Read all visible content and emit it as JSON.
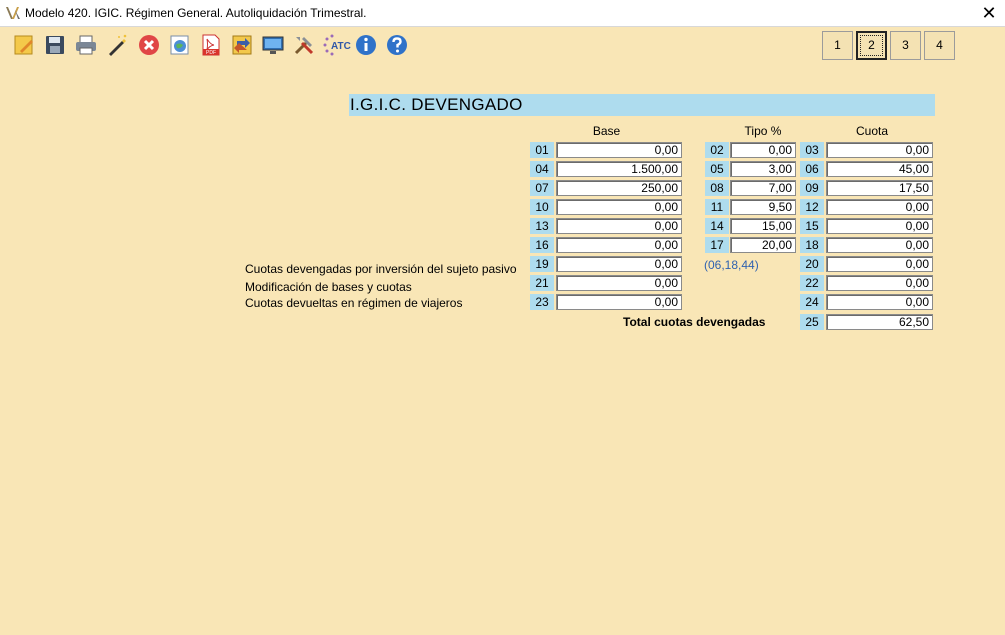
{
  "window": {
    "title": "Modelo 420. IGIC. Régimen General. Autoliquidación Trimestral.",
    "close_glyph": "✕"
  },
  "toolbar": {
    "icons": [
      "new-icon",
      "save-icon",
      "print-icon",
      "wizard-icon",
      "cancel-icon",
      "globe-icon",
      "pdf-icon",
      "import-icon",
      "monitor-icon",
      "tools-icon",
      "atc-icon",
      "info-icon",
      "help-icon"
    ],
    "atc_label": "ATC",
    "pdf_label": "PDF"
  },
  "pages": {
    "buttons": [
      "1",
      "2",
      "3",
      "4"
    ],
    "active": "2"
  },
  "section": {
    "title": "I.G.I.C. DEVENGADO"
  },
  "columns": {
    "base": "Base",
    "tipo": "Tipo %",
    "cuota": "Cuota"
  },
  "rows": [
    {
      "base_code": "01",
      "base": "0,00",
      "tipo_code": "02",
      "tipo": "0,00",
      "cuota_code": "03",
      "cuota": "0,00"
    },
    {
      "base_code": "04",
      "base": "1.500,00",
      "tipo_code": "05",
      "tipo": "3,00",
      "cuota_code": "06",
      "cuota": "45,00"
    },
    {
      "base_code": "07",
      "base": "250,00",
      "tipo_code": "08",
      "tipo": "7,00",
      "cuota_code": "09",
      "cuota": "17,50"
    },
    {
      "base_code": "10",
      "base": "0,00",
      "tipo_code": "11",
      "tipo": "9,50",
      "cuota_code": "12",
      "cuota": "0,00"
    },
    {
      "base_code": "13",
      "base": "0,00",
      "tipo_code": "14",
      "tipo": "15,00",
      "cuota_code": "15",
      "cuota": "0,00"
    },
    {
      "base_code": "16",
      "base": "0,00",
      "tipo_code": "17",
      "tipo": "20,00",
      "cuota_code": "18",
      "cuota": "0,00"
    }
  ],
  "extra_rows": [
    {
      "label": "Cuotas devengadas por inversión del sujeto pasivo",
      "base_code": "19",
      "base": "0,00",
      "cuota_code": "20",
      "cuota": "0,00"
    },
    {
      "label": "Modificación de bases y cuotas",
      "base_code": "21",
      "base": "0,00",
      "cuota_code": "22",
      "cuota": "0,00"
    },
    {
      "label": "Cuotas devueltas en régimen de viajeros",
      "base_code": "23",
      "base": "0,00",
      "cuota_code": "24",
      "cuota": "0,00"
    }
  ],
  "ref_note": "(06,18,44)",
  "total": {
    "label": "Total cuotas devengadas",
    "code": "25",
    "value": "62,50"
  },
  "colors": {
    "background": "#f9e6b6",
    "code_cell": "#aedcee",
    "section_bar": "#aedcee",
    "link": "#2f62b0"
  }
}
